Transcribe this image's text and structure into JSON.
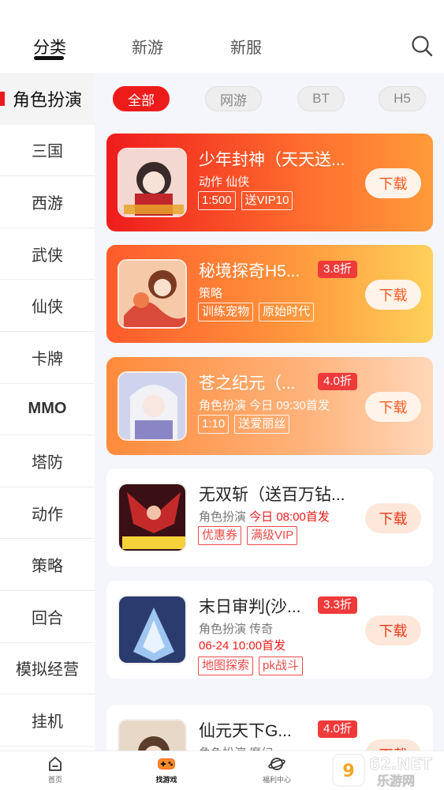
{
  "top_tabs": [
    {
      "label": "分类",
      "active": true
    },
    {
      "label": "新游",
      "active": false
    },
    {
      "label": "新服",
      "active": false
    }
  ],
  "sidebar": {
    "items": [
      {
        "label": "角色扮演",
        "active": true
      },
      {
        "label": "三国"
      },
      {
        "label": "西游"
      },
      {
        "label": "武侠"
      },
      {
        "label": "仙侠"
      },
      {
        "label": "卡牌"
      },
      {
        "label": "MMO"
      },
      {
        "label": "塔防"
      },
      {
        "label": "动作"
      },
      {
        "label": "策略"
      },
      {
        "label": "回合"
      },
      {
        "label": "模拟经营"
      },
      {
        "label": "挂机"
      }
    ]
  },
  "filters": [
    {
      "label": "全部",
      "active": true
    },
    {
      "label": "网游"
    },
    {
      "label": "BT"
    },
    {
      "label": "H5"
    }
  ],
  "games": [
    {
      "name": "少年封神（天天送...",
      "sub": "动作  仙侠",
      "sub_highlight": "",
      "tags": [
        "1:500",
        "送VIP10"
      ],
      "discount": "",
      "download": "下载"
    },
    {
      "name": "秘境探奇H5...",
      "sub": "策略",
      "sub_highlight": "",
      "tags": [
        "训练宠物",
        "原始时代"
      ],
      "discount": "3.8折",
      "download": "下载"
    },
    {
      "name": "苍之纪元（...",
      "sub": "角色扮演  今日 09:30首发",
      "sub_highlight": "",
      "tags": [
        "1:10",
        "送爱丽丝"
      ],
      "discount": "4.0折",
      "download": "下载"
    },
    {
      "name": "无双斩（送百万钻...",
      "sub": "角色扮演  ",
      "sub_highlight": "今日 08:00首发",
      "tags": [
        "优惠券",
        "满级VIP"
      ],
      "discount": "",
      "download": "下载"
    },
    {
      "name": "末日审判(沙...",
      "sub": "角色扮演  传奇",
      "sub_highlight": "06-24 10:00首发",
      "tags": [
        "地图探索",
        "pk战斗"
      ],
      "discount": "3.3折",
      "download": "下载"
    },
    {
      "name": "仙元天下G...",
      "sub": "角色扮演  魔幻",
      "sub_highlight": "",
      "tags": [],
      "discount": "4.0折",
      "download": "下载"
    }
  ],
  "bottom_nav": [
    {
      "label": "首页",
      "icon": "home-icon"
    },
    {
      "label": "找游戏",
      "icon": "gamepad-icon",
      "active": true
    },
    {
      "label": "福利中心",
      "icon": "planet-icon"
    }
  ],
  "watermark": "962.NET 乐游网",
  "colors": {
    "accent": "#ee1b1b",
    "download_text": "#ff5a1f"
  }
}
